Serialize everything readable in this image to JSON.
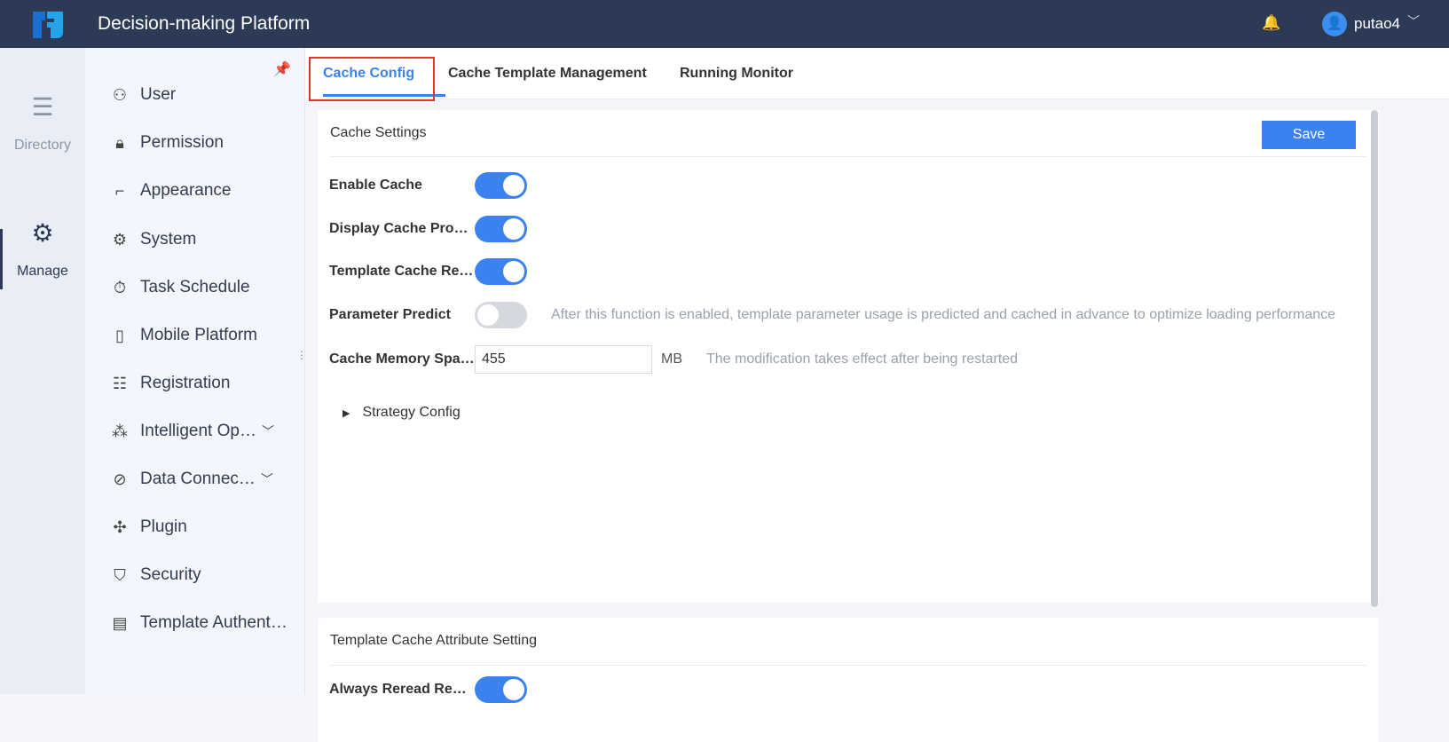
{
  "header": {
    "title": "Decision-making Platform",
    "username": "putao4"
  },
  "rail": [
    {
      "label": "Directory"
    },
    {
      "label": "Manage"
    }
  ],
  "menu": [
    {
      "label": "User",
      "icon": "user-icon"
    },
    {
      "label": "Permission",
      "icon": "lock-icon"
    },
    {
      "label": "Appearance",
      "icon": "paint-roller-icon"
    },
    {
      "label": "System",
      "icon": "gear-icon"
    },
    {
      "label": "Task Schedule",
      "icon": "timer-icon"
    },
    {
      "label": "Mobile Platform",
      "icon": "tablet-icon"
    },
    {
      "label": "Registration",
      "icon": "registration-icon"
    },
    {
      "label": "Intelligent Op…",
      "icon": "network-icon"
    },
    {
      "label": "Data Connec…",
      "icon": "paperclip-icon"
    },
    {
      "label": "Plugin",
      "icon": "puzzle-icon"
    },
    {
      "label": "Security",
      "icon": "shield-icon"
    },
    {
      "label": "Template Authent…",
      "icon": "doc-search-icon"
    }
  ],
  "tabs": [
    "Cache Config",
    "Cache Template Management",
    "Running Monitor"
  ],
  "cache_settings": {
    "title": "Cache Settings",
    "save_label": "Save",
    "enable_cache": {
      "label": "Enable Cache",
      "on": true
    },
    "display_cache": {
      "label": "Display Cache Pro…",
      "on": true
    },
    "template_cache": {
      "label": "Template Cache Re…",
      "on": true
    },
    "parameter_predict": {
      "label": "Parameter Predict",
      "on": false,
      "hint": "After this function is enabled, template parameter usage is predicted and cached in advance to optimize loading performance"
    },
    "memory": {
      "label": "Cache Memory Spa…",
      "value": "455",
      "unit": "MB",
      "hint": "The modification takes effect after being restarted"
    },
    "strategy": "Strategy Config"
  },
  "template_attr": {
    "title": "Template Cache Attribute Setting",
    "always_reread": {
      "label": "Always Reread Rep…",
      "on": true
    }
  }
}
